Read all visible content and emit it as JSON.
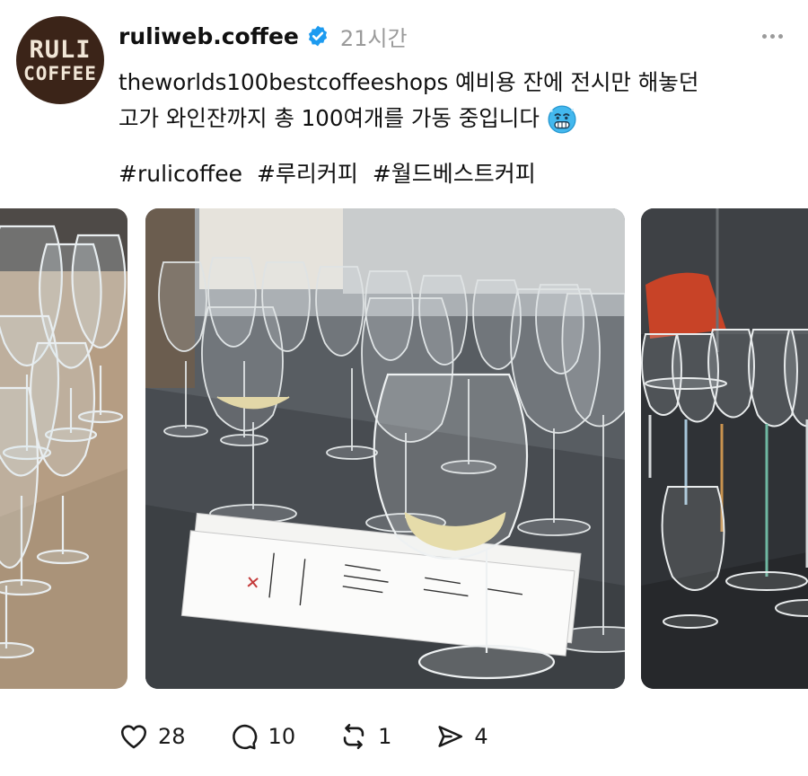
{
  "profile": {
    "avatar_line1": "RULI",
    "avatar_line2": "COFFEE",
    "username": "ruliweb.coffee",
    "time": "21시간"
  },
  "post": {
    "line1": "theworlds100bestcoffeeshops 예비용 잔에 전시만 해놓던",
    "line2": "고가 와인잔까지 총 100여개를 가동 중입니다",
    "emoji": "cold-face-emoji",
    "hashtags": [
      "#rulicoffee",
      "#루리커피",
      "#월드베스트커피"
    ]
  },
  "media": [
    {
      "name": "wine-glasses-on-wood-table"
    },
    {
      "name": "wine-glasses-with-cupping-sheets"
    },
    {
      "name": "wine-glasses-colored-stems"
    }
  ],
  "actions": {
    "likes": "28",
    "replies": "10",
    "reposts": "1",
    "shares": "4"
  },
  "colors": {
    "verified": "#1d9bf0",
    "secondary_text": "#9a9a9a",
    "avatar_bg": "#3b2418"
  },
  "icons": [
    "verified-badge-icon",
    "more-icon",
    "heart-icon",
    "comment-icon",
    "repost-icon",
    "share-icon"
  ]
}
